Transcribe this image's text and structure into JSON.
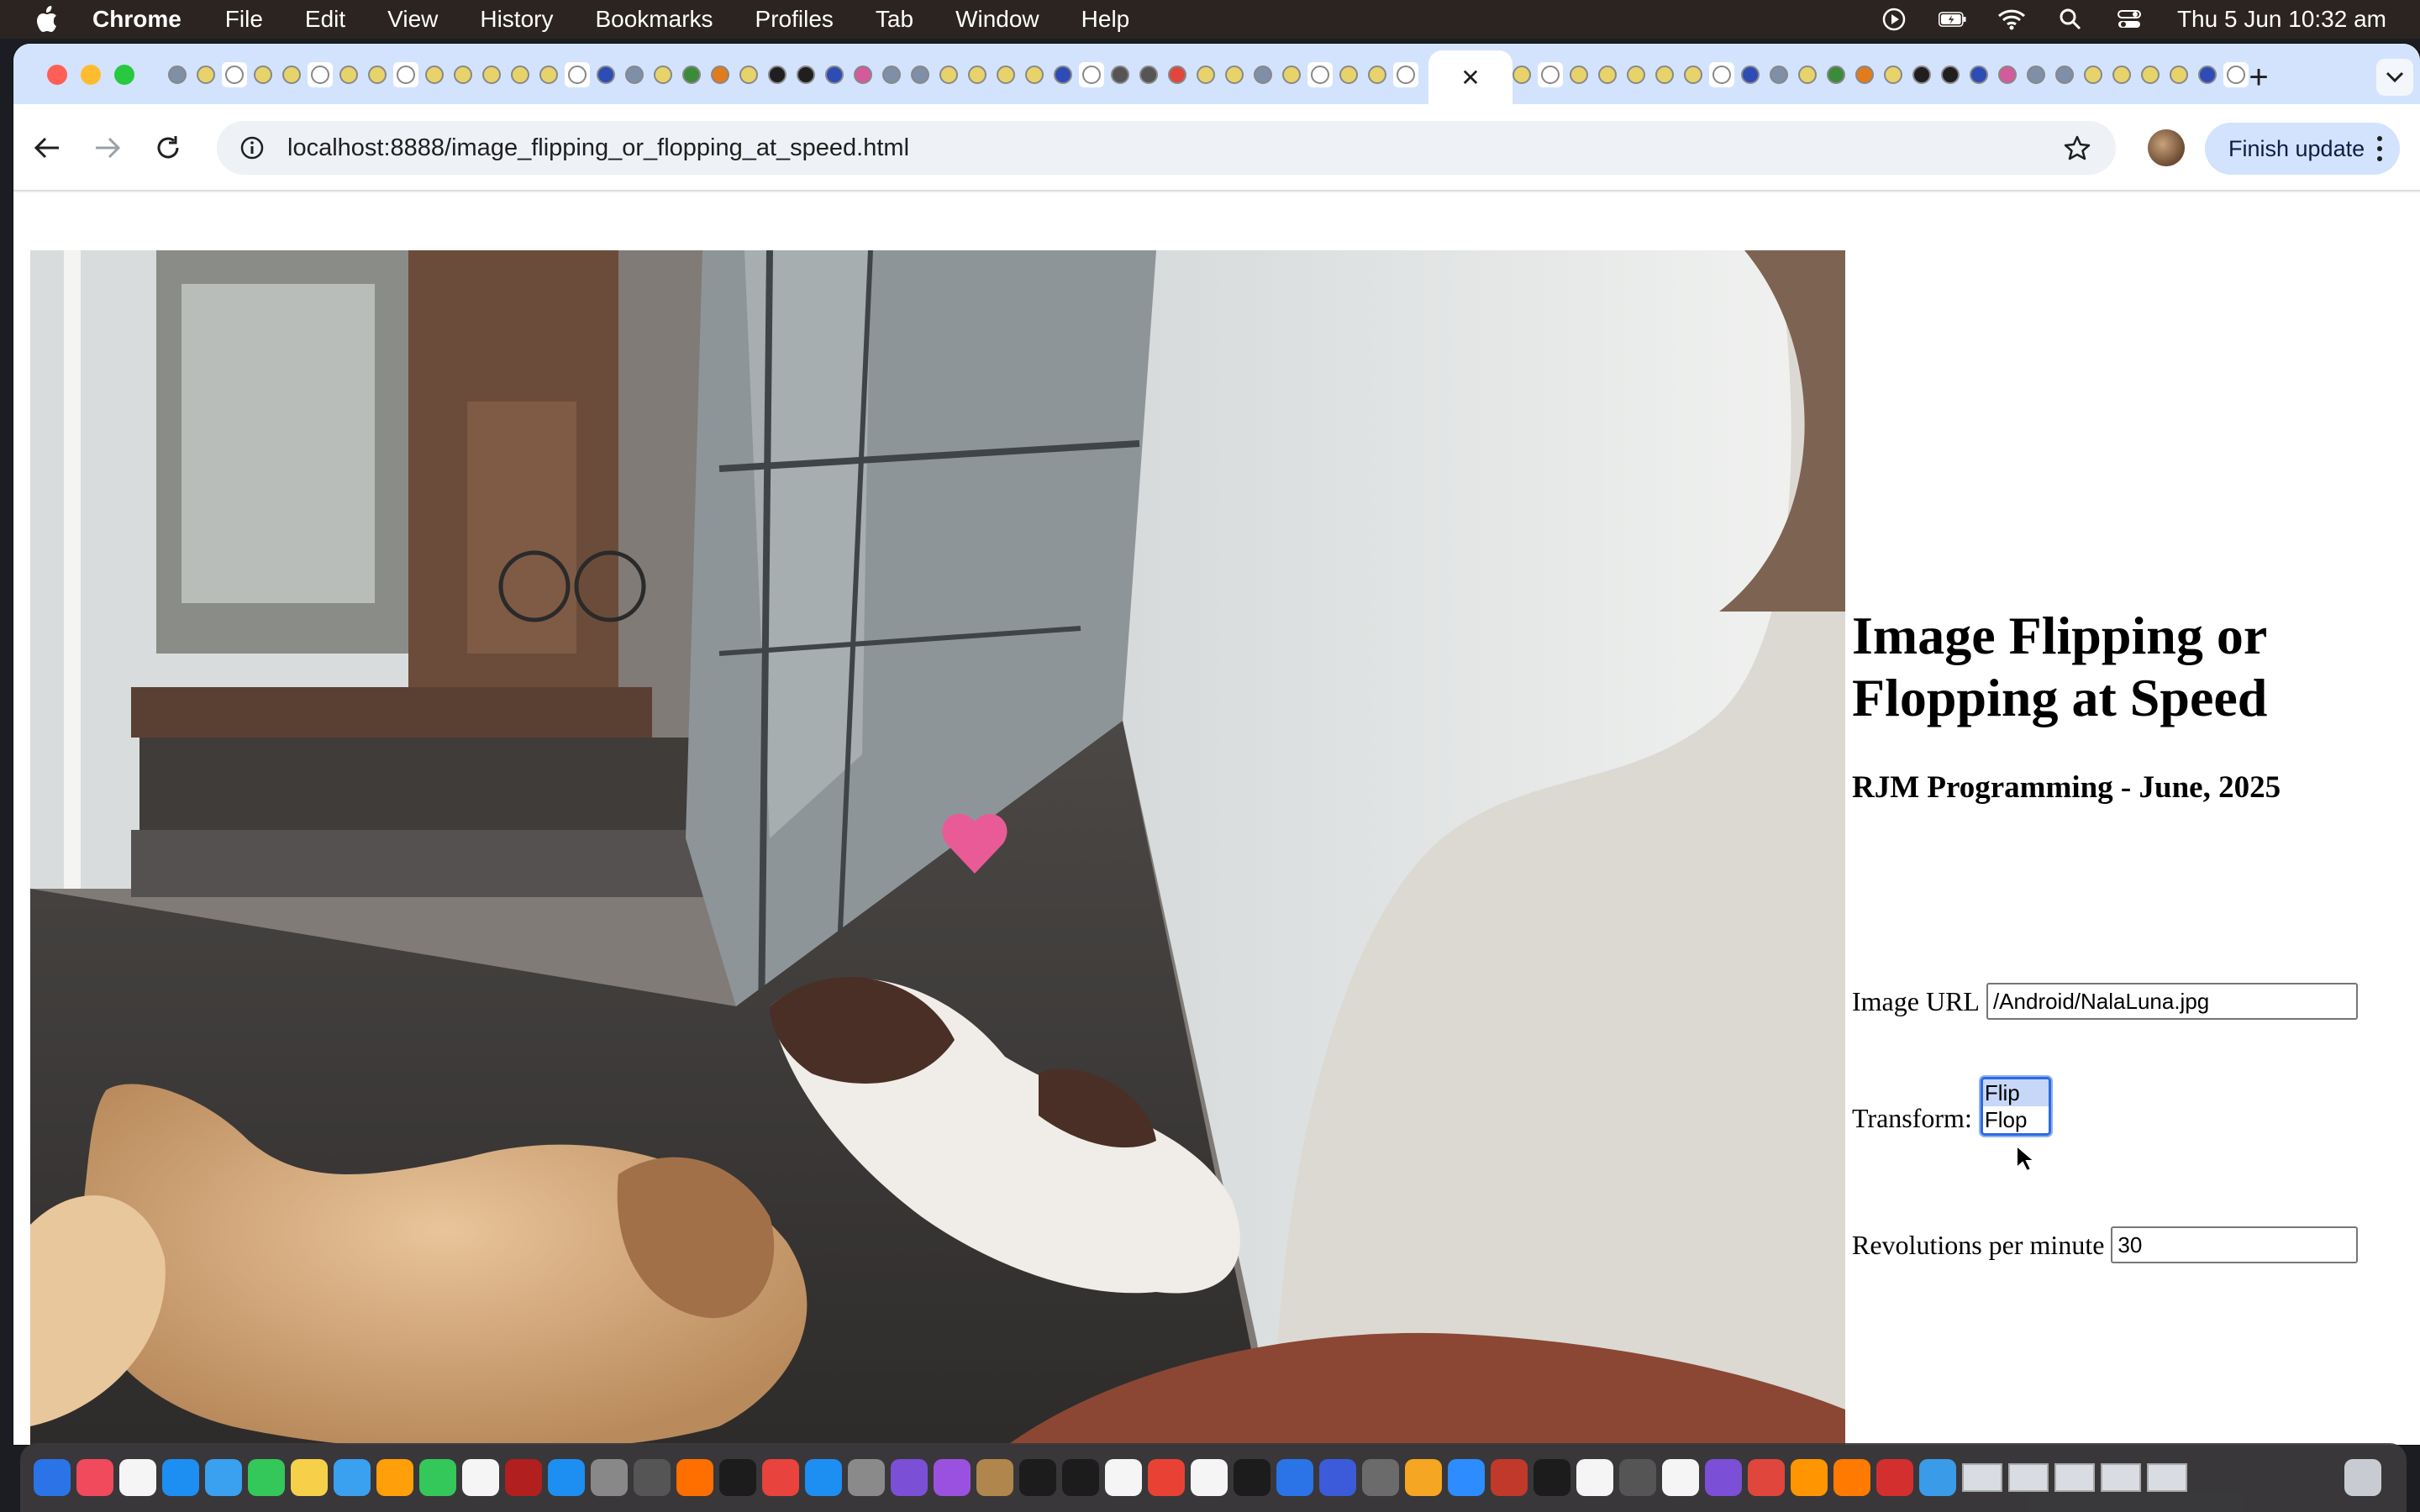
{
  "menubar": {
    "app_name": "Chrome",
    "items": [
      "File",
      "Edit",
      "View",
      "History",
      "Bookmarks",
      "Profiles",
      "Tab",
      "Window",
      "Help"
    ],
    "clock": "Thu 5 Jun  10:32 am",
    "status_icons": [
      "play-circle-icon",
      "battery-charging-icon",
      "wifi-icon",
      "spotlight-search-icon",
      "control-center-icon"
    ]
  },
  "browser": {
    "tab_close_symbol": "✕",
    "new_tab_symbol": "+",
    "url": "localhost:8888/image_flipping_or_flopping_at_speed.html",
    "update_button": "Finish update"
  },
  "page": {
    "title": "Image Flipping or Flopping at Speed",
    "subtitle": "RJM Programming - June, 2025",
    "image_url_label": "Image URL",
    "image_url_value": "/Android/NalaLuna.jpg",
    "transform_label": "Transform:",
    "transform_options": [
      "Flip",
      "Flop"
    ],
    "transform_selected": "Flip",
    "rpm_label": "Revolutions per minute",
    "rpm_value": "30"
  },
  "colors": {
    "tabstrip": "#d3e3fd",
    "menubar": "#2b2420",
    "accent": "#2d6ae0"
  }
}
